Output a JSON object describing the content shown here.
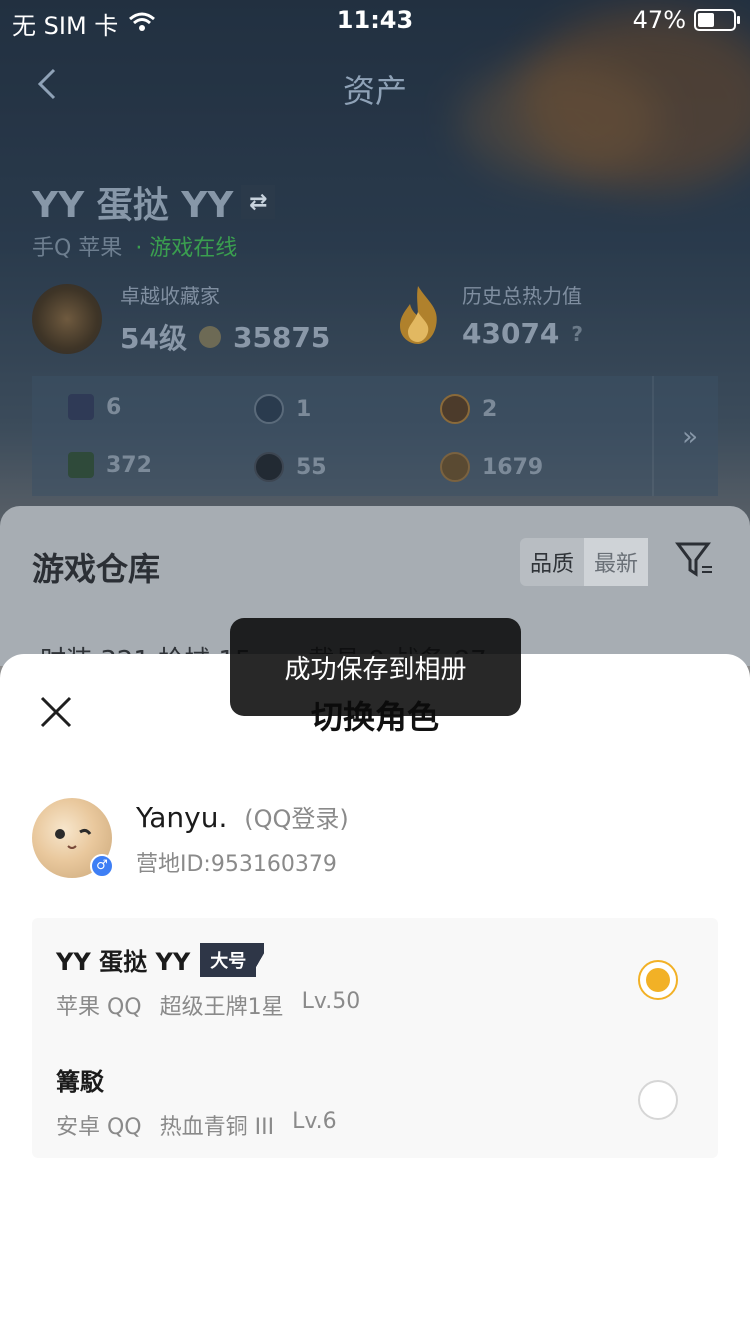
{
  "status_bar": {
    "carrier": "无 SIM 卡",
    "time": "11:43",
    "battery": "47%"
  },
  "header": {
    "title": "资产"
  },
  "player": {
    "name": "YY 蛋挞 YY",
    "platform": "手Q 苹果",
    "online_status": "· 游戏在线",
    "collector": {
      "label": "卓越收藏家",
      "level": "54级",
      "score": "35875"
    },
    "heat": {
      "label": "历史总热力值",
      "value": "43074"
    },
    "items": [
      "6",
      "1",
      "2",
      "372",
      "55",
      "1679"
    ],
    "more": "»"
  },
  "warehouse": {
    "title": "游戏仓库",
    "sort_quality": "品质",
    "sort_newest": "最新",
    "tabs_text": "时装 321   枪械 15x   ...   载具 9   战备 87"
  },
  "toast": {
    "message": "成功保存到相册"
  },
  "sheet": {
    "title": "切换角色",
    "account": {
      "name": "Yanyu.",
      "login": "(QQ登录)",
      "id": "营地ID:953160379"
    },
    "roles": [
      {
        "name": "YY 蛋挞 YY",
        "tag": "大号",
        "platform": "苹果 QQ",
        "rank": "超级王牌1星",
        "level": "Lv.50",
        "selected": true
      },
      {
        "name": "篝駁",
        "platform": "安卓 QQ",
        "rank": "热血青铜 III",
        "level": "Lv.6",
        "selected": false
      }
    ]
  },
  "colors": {
    "accent": "#f2b126",
    "tag_bg": "#2e3647"
  }
}
